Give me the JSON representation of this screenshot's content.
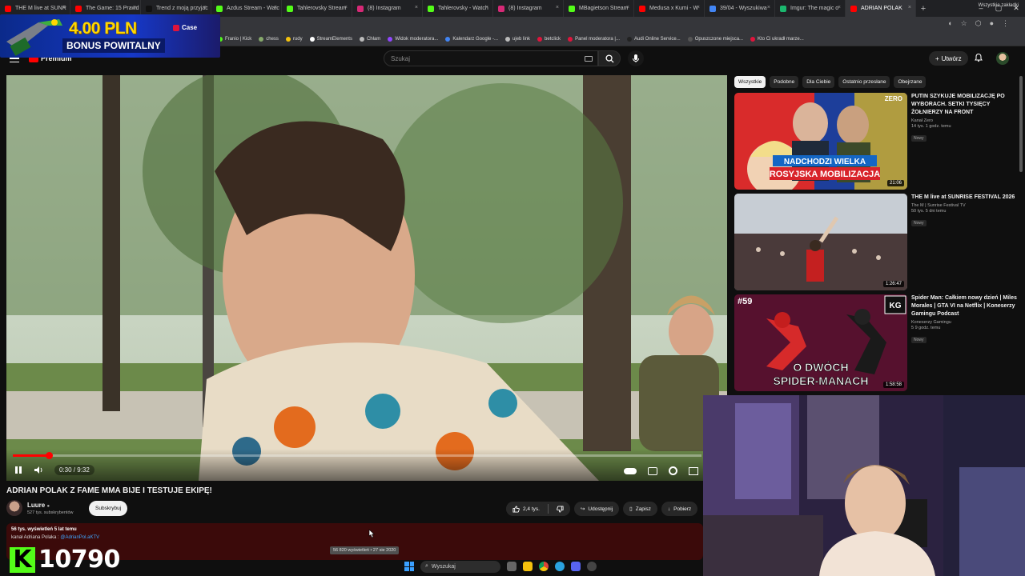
{
  "browser": {
    "tabs": [
      {
        "label": "THE M live at SUNR",
        "color": "#ff0000"
      },
      {
        "label": "The Game: 15 Prawd",
        "color": "#ff0000"
      },
      {
        "label": "Trend z moją przyjac",
        "color": "#111111"
      },
      {
        "label": "Azdus Stream - Watc",
        "color": "#53fc18"
      },
      {
        "label": "Tahlerovsky Stream",
        "color": "#53fc18"
      },
      {
        "label": "(8) Instagram",
        "color": "#d62976"
      },
      {
        "label": "Tahlerovsky - Watch",
        "color": "#53fc18"
      },
      {
        "label": "(8) Instagram",
        "color": "#d62976"
      },
      {
        "label": "MBagietson Stream",
        "color": "#53fc18"
      },
      {
        "label": "Medusa x Kumi - W",
        "color": "#ff0000"
      },
      {
        "label": "39/04 - Wyszukiwa",
        "color": "#4285f4"
      },
      {
        "label": "Imgur: The magic o",
        "color": "#1bb76e"
      },
      {
        "label": "ADRIAN POLAK",
        "color": "#ff0000",
        "active": true
      }
    ],
    "bookmarks": [
      {
        "label": "Franio | Kick",
        "color": "#53fc18"
      },
      {
        "label": "chess",
        "color": "#86a96b"
      },
      {
        "label": "rudy",
        "color": "#f4c20d"
      },
      {
        "label": "StreamElements",
        "color": "#ffffff"
      },
      {
        "label": "Chłam",
        "color": "#bbbbbb"
      },
      {
        "label": "Widok moderatora...",
        "color": "#9146ff"
      },
      {
        "label": "Kalendarz Google -...",
        "color": "#4285f4"
      },
      {
        "label": "ujeb link",
        "color": "#bbbbbb"
      },
      {
        "label": "betclick",
        "color": "#e0143c"
      },
      {
        "label": "Panel moderatora |...",
        "color": "#e0143c"
      },
      {
        "label": "Audi Online Service...",
        "color": "#222222"
      },
      {
        "label": "Opuszczone miejsca...",
        "color": "#555555"
      },
      {
        "label": "Kto Ci ukradł marze...",
        "color": "#e0143c"
      }
    ],
    "bookmarks_right": "Wszystkie zakładki"
  },
  "promo": {
    "amount": "4.00 PLN",
    "bonus": "BONUS POWITALNY",
    "brand": "Case"
  },
  "header": {
    "brand": "Premium",
    "search_placeholder": "Szukaj",
    "create_label": "Utwórz"
  },
  "player": {
    "time": "0:30 / 9:32",
    "progress_fraction": 0.052
  },
  "video": {
    "title": "ADRIAN POLAK Z FAME MMA BIJE I TESTUJE EKIPĘ!",
    "channel": "Luure",
    "subs": "527 tys. subskrybentów",
    "subscribe_label": "Subskrybuj",
    "likes": "2,4 tys.",
    "share_label": "Udostępnij",
    "save_label": "Zapisz",
    "download_label": "Pobierz"
  },
  "description": {
    "line1": "56 tys. wyświetleń  5 lat temu",
    "line2_prefix": "kanał Adriana Polaka : ",
    "line2_link": "@AdrianPol.aKTV",
    "tooltip": "56 820 wyświetleń • 27 sie 2020"
  },
  "kick": {
    "letter": "K",
    "count": "10790"
  },
  "taskbar": {
    "search_label": "Wyszukaj"
  },
  "sidebar": {
    "chips": [
      "Wszystkie",
      "Podobne",
      "Dla Ciebie",
      "Ostatnio przesłane",
      "Obejrzane"
    ],
    "recommendations": [
      {
        "title": "PUTIN SZYKUJE MOBILIZACJĘ PO WYBORACH. SETKI TYSIĘCY ŻOŁNIERZY NA FRONT",
        "channel": "Kanał Zero",
        "meta": "14 tys.  1 godz. temu",
        "badge": "Nowy",
        "duration": "21:06",
        "thumb_banner1": "NADCHODZI WIELKA",
        "thumb_banner2": "ROSYJSKA MOBILIZACJA",
        "thumb_tag": "ZERO"
      },
      {
        "title": "THE M live at SUNRISE FESTIVAL 2026",
        "channel": "The M  |  Sunrise Festival TV",
        "meta": "50 tys.  5 dni temu",
        "badge": "Nowy",
        "duration": "1:26:47"
      },
      {
        "title": "Spider Man: Całkiem nowy dzień | Miles Morales | GTA VI na Netflix | Koneserzy Gamingu Podcast",
        "channel": "Koneserzy Gamingu",
        "meta": "5  9 godz. temu",
        "badge": "Nowy",
        "duration": "1:58:58",
        "thumb_banner1": "O DWÓCH",
        "thumb_banner2": "SPIDER-MANACH",
        "thumb_tag": "#59",
        "thumb_logo": "KG"
      }
    ]
  },
  "colors": {
    "background": "#0f0f0f",
    "accent": "#ff0000",
    "kick_green": "#53fc18",
    "description_bg": "#3b0a0a"
  }
}
